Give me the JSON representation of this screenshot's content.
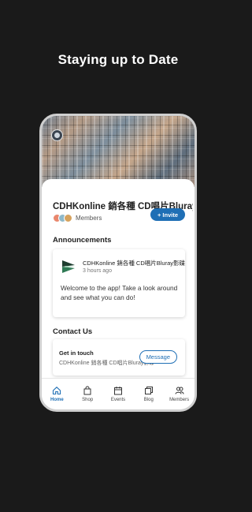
{
  "headline": "Staying up to Date",
  "site": {
    "title": "CDHKonline 銷各種 CD唱片Bluray影碟",
    "members_label": "Members",
    "invite_label": "Invite",
    "invite_plus": "+"
  },
  "announcements": {
    "section_title": "Announcements",
    "post": {
      "author": "CDHKonline 銷各種 CD唱片Bluray影碟",
      "time": "3 hours ago",
      "body": "Welcome to the app! Take a look around and see what you can do!"
    }
  },
  "contact": {
    "section_title": "Contact Us",
    "card_title": "Get in touch",
    "card_subtitle": "CDHKonline 銷各種 CD唱片Bluray影碟",
    "message_label": "Message"
  },
  "tabs": [
    {
      "label": "Home",
      "icon": "home-icon",
      "active": true
    },
    {
      "label": "Shop",
      "icon": "shopping-bag-icon",
      "active": false
    },
    {
      "label": "Events",
      "icon": "calendar-icon",
      "active": false
    },
    {
      "label": "Blog",
      "icon": "blog-icon",
      "active": false
    },
    {
      "label": "Members",
      "icon": "members-icon",
      "active": false
    }
  ],
  "colors": {
    "accent": "#1f6fb5",
    "background": "#1a1a1a"
  }
}
